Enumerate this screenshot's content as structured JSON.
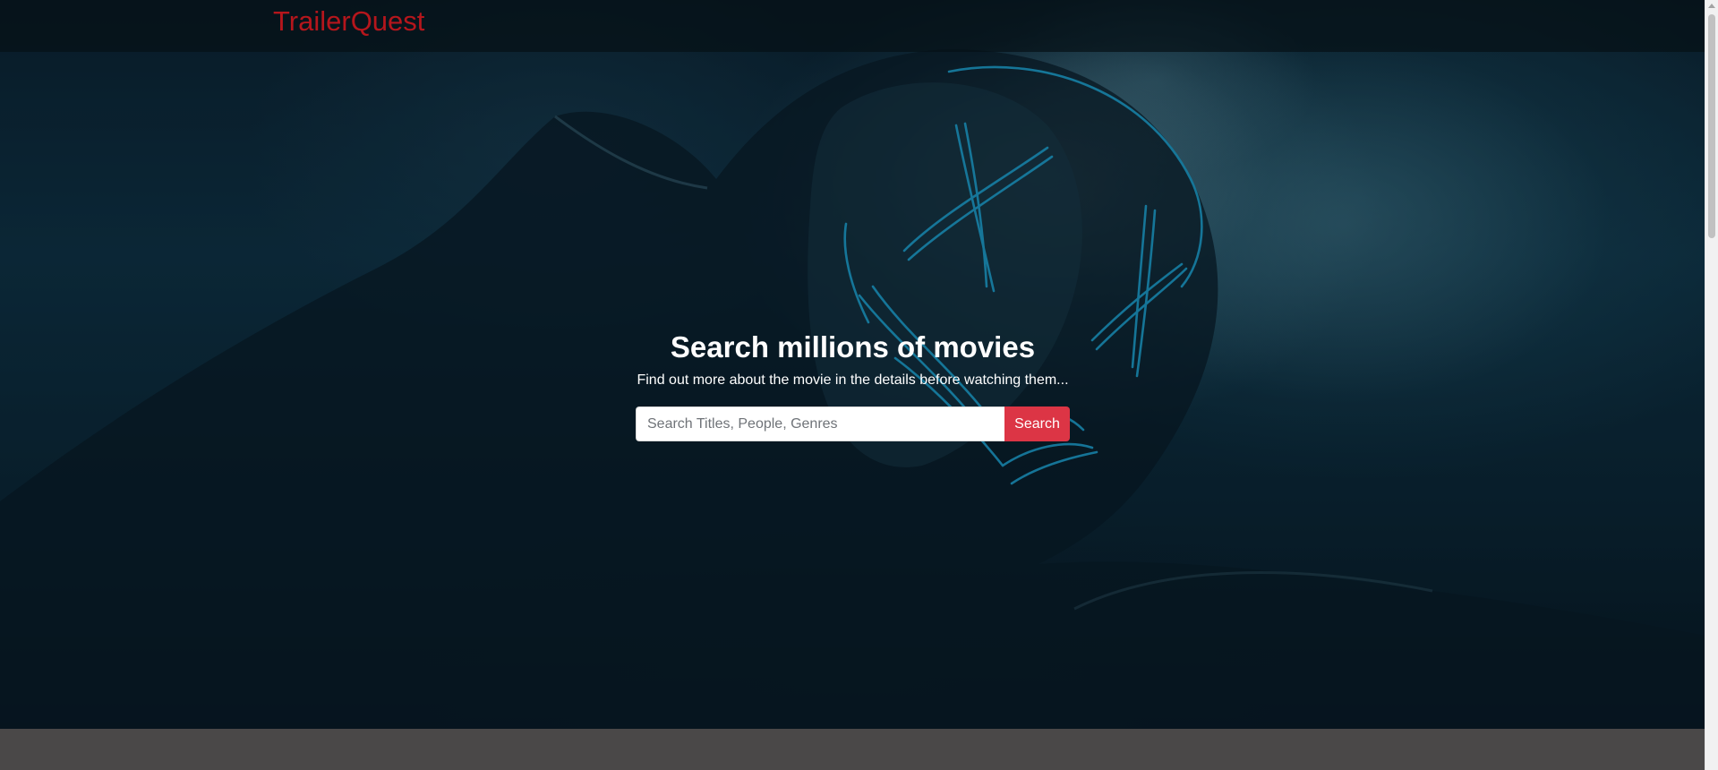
{
  "navbar": {
    "brand": "TrailerQuest",
    "brand_color": "#b5161c"
  },
  "hero": {
    "title": "Search millions of movies",
    "subtitle": "Find out more about the movie in the details before watching them...",
    "background_image": "hooded-figure-neon-mask"
  },
  "search": {
    "placeholder": "Search Titles, People, Genres",
    "value": "",
    "button_label": "Search",
    "button_color": "#dc3545"
  },
  "colors": {
    "bottom_section": "#4a4848"
  }
}
